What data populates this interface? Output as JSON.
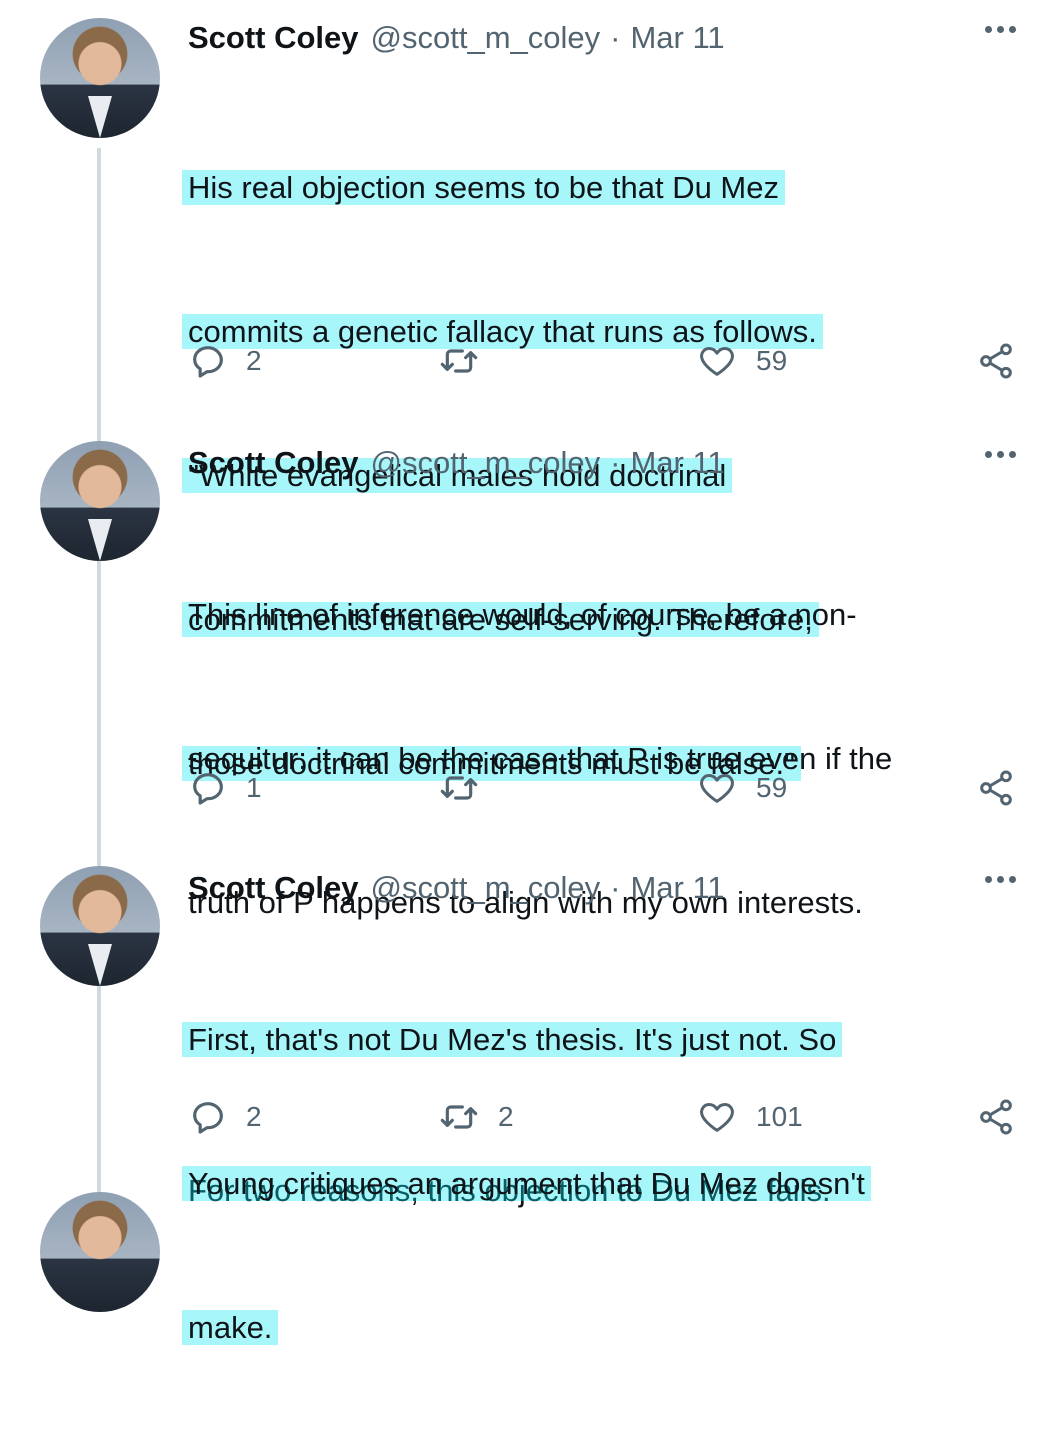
{
  "tweets": [
    {
      "author": "Scott Coley",
      "handle": "@scott_m_coley",
      "separator": "·",
      "date": "Mar 11",
      "lines": [
        "His real objection seems to be that Du Mez",
        "commits a genetic fallacy that runs as follows.",
        "\"White evangelical males hold doctrinal",
        "commitments that are self-serving. Therefore,",
        "those doctrinal commitments must be false.\""
      ],
      "highlighted": true,
      "replies": "2",
      "retweets": "",
      "likes": "59"
    },
    {
      "author": "Scott Coley",
      "handle": "@scott_m_coley",
      "separator": "·",
      "date": "Mar 11",
      "lines": [
        "This line of inference would, of course, be a non-",
        "sequitur: it can be the case that P is true even if the",
        "truth of P happens to align with my own interests.",
        "",
        "For two reasons, this objection to Du Mez fails."
      ],
      "highlighted": false,
      "replies": "1",
      "retweets": "",
      "likes": "59"
    },
    {
      "author": "Scott Coley",
      "handle": "@scott_m_coley",
      "separator": "·",
      "date": "Mar 11",
      "lines": [
        "First, that's not Du Mez's thesis. It's just not. So",
        "Young critiques an argument that Du Mez doesn't",
        "make."
      ],
      "highlighted": true,
      "replies": "2",
      "retweets": "2",
      "likes": "101"
    }
  ],
  "icons": {
    "more": "more-horizontal-icon",
    "reply": "reply-icon",
    "retweet": "retweet-icon",
    "like": "heart-icon",
    "share": "share-icon"
  },
  "colors": {
    "text": "#0f1419",
    "muted": "#536471",
    "thread_line": "#cfd9de",
    "highlight": "#00e6f0"
  }
}
